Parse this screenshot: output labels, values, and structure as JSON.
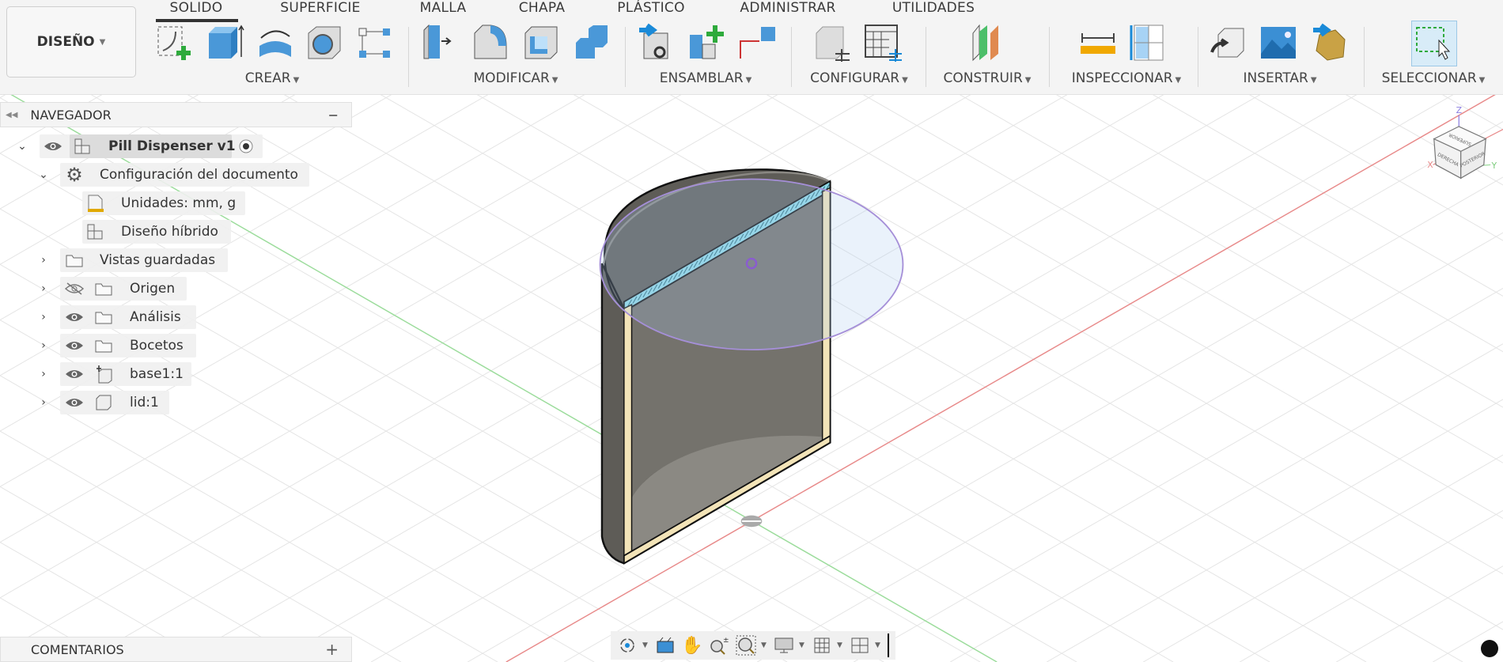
{
  "workspace": {
    "label": "DISEÑO"
  },
  "tabs": [
    "SOLIDO",
    "SUPERFICIE",
    "MALLA",
    "CHAPA",
    "PLÁSTICO",
    "ADMINISTRAR",
    "UTILIDADES"
  ],
  "active_tab": "SOLIDO",
  "groups": [
    "CREAR",
    "MODIFICAR",
    "ENSAMBLAR",
    "CONFIGURAR",
    "CONSTRUIR",
    "INSPECCIONAR",
    "INSERTAR",
    "SELECCIONAR"
  ],
  "navigator": {
    "title": "NAVEGADOR",
    "items": [
      {
        "label": "Pill Dispenser v1",
        "icon": "component-icon"
      },
      {
        "label": "Configuración del documento",
        "icon": "gear-icon"
      },
      {
        "label": "Unidades: mm, g",
        "icon": "document-icon"
      },
      {
        "label": "Diseño híbrido",
        "icon": "component-icon"
      },
      {
        "label": "Vistas guardadas",
        "icon": "folder-icon"
      },
      {
        "label": "Origen",
        "icon": "folder-icon"
      },
      {
        "label": "Análisis",
        "icon": "folder-icon"
      },
      {
        "label": "Bocetos",
        "icon": "folder-icon"
      },
      {
        "label": "base1:1",
        "icon": "anchored-body-icon"
      },
      {
        "label": "lid:1",
        "icon": "body-icon"
      }
    ]
  },
  "comments": {
    "title": "COMENTARIOS"
  },
  "viewcube": {
    "top": "SUPERIOR",
    "left": "DERECHA",
    "right": "POSTERIOR",
    "x": "X",
    "y": "Y",
    "z": "Z"
  },
  "colors": {
    "x_axis": "#e88a8a",
    "y_axis": "#9bdc9b",
    "section_hatch": "#8fd8e6",
    "section_face": "#f3e4b8",
    "body": "#5e5c57",
    "accent": "#0696d7"
  }
}
